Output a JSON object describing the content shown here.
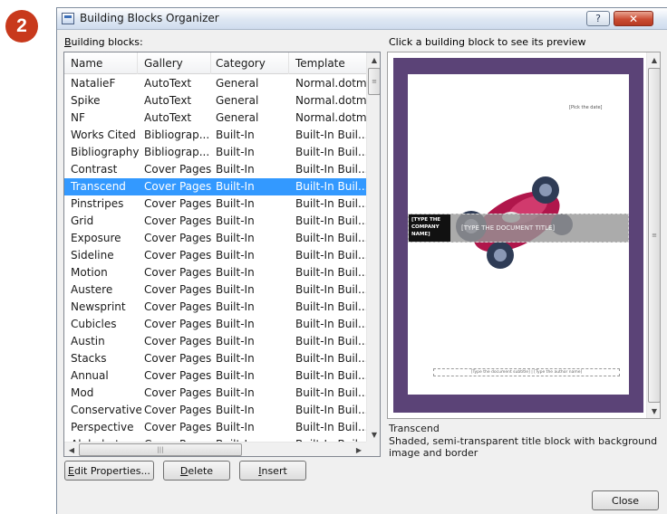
{
  "badge": "2",
  "dialog": {
    "title": "Building Blocks Organizer",
    "help_label": "?",
    "close_label": "✕"
  },
  "blocks_label_key": "B",
  "blocks_label_rest": "uilding blocks:",
  "preview_label": "Click a building block to see its preview",
  "columns": [
    "Name",
    "Gallery",
    "Category",
    "Template"
  ],
  "rows": [
    [
      "NatalieF",
      "AutoText",
      "General",
      "Normal.dotm"
    ],
    [
      "Spike",
      "AutoText",
      "General",
      "Normal.dotm"
    ],
    [
      "NF",
      "AutoText",
      "General",
      "Normal.dotm"
    ],
    [
      "Works Cited",
      "Bibliograp...",
      "Built-In",
      "Built-In Buil..."
    ],
    [
      "Bibliography",
      "Bibliograp...",
      "Built-In",
      "Built-In Buil..."
    ],
    [
      "Contrast",
      "Cover Pages",
      "Built-In",
      "Built-In Buil..."
    ],
    [
      "Transcend",
      "Cover Pages",
      "Built-In",
      "Built-In Buil..."
    ],
    [
      "Pinstripes",
      "Cover Pages",
      "Built-In",
      "Built-In Buil..."
    ],
    [
      "Grid",
      "Cover Pages",
      "Built-In",
      "Built-In Buil..."
    ],
    [
      "Exposure",
      "Cover Pages",
      "Built-In",
      "Built-In Buil..."
    ],
    [
      "Sideline",
      "Cover Pages",
      "Built-In",
      "Built-In Buil..."
    ],
    [
      "Motion",
      "Cover Pages",
      "Built-In",
      "Built-In Buil..."
    ],
    [
      "Austere",
      "Cover Pages",
      "Built-In",
      "Built-In Buil..."
    ],
    [
      "Newsprint",
      "Cover Pages",
      "Built-In",
      "Built-In Buil..."
    ],
    [
      "Cubicles",
      "Cover Pages",
      "Built-In",
      "Built-In Buil..."
    ],
    [
      "Austin",
      "Cover Pages",
      "Built-In",
      "Built-In Buil..."
    ],
    [
      "Stacks",
      "Cover Pages",
      "Built-In",
      "Built-In Buil..."
    ],
    [
      "Annual",
      "Cover Pages",
      "Built-In",
      "Built-In Buil..."
    ],
    [
      "Mod",
      "Cover Pages",
      "Built-In",
      "Built-In Buil..."
    ],
    [
      "Conservative",
      "Cover Pages",
      "Built-In",
      "Built-In Buil..."
    ],
    [
      "Perspective",
      "Cover Pages",
      "Built-In",
      "Built-In Buil..."
    ],
    [
      "Alphabet",
      "Cover Pages",
      "Built-In",
      "Built-In Buil..."
    ]
  ],
  "selected_index": 6,
  "buttons": {
    "edit_key": "E",
    "edit_rest": "dit Properties...",
    "delete_key": "D",
    "delete_rest": "elete",
    "insert_key": "I",
    "insert_rest": "nsert",
    "close": "Close"
  },
  "preview": {
    "pick_date": "[Pick the date]",
    "company": "[TYPE THE COMPANY NAME]",
    "doc_title": "[TYPE THE DOCUMENT TITLE]",
    "subtitle": "[Type the document subtitle] | [Type the author name]"
  },
  "selection_name": "Transcend",
  "selection_desc": "Shaded, semi-transparent title block with background image and border",
  "colors": {
    "selection": "#3399ff",
    "preview_border": "#5b4377",
    "badge": "#c8391c"
  }
}
